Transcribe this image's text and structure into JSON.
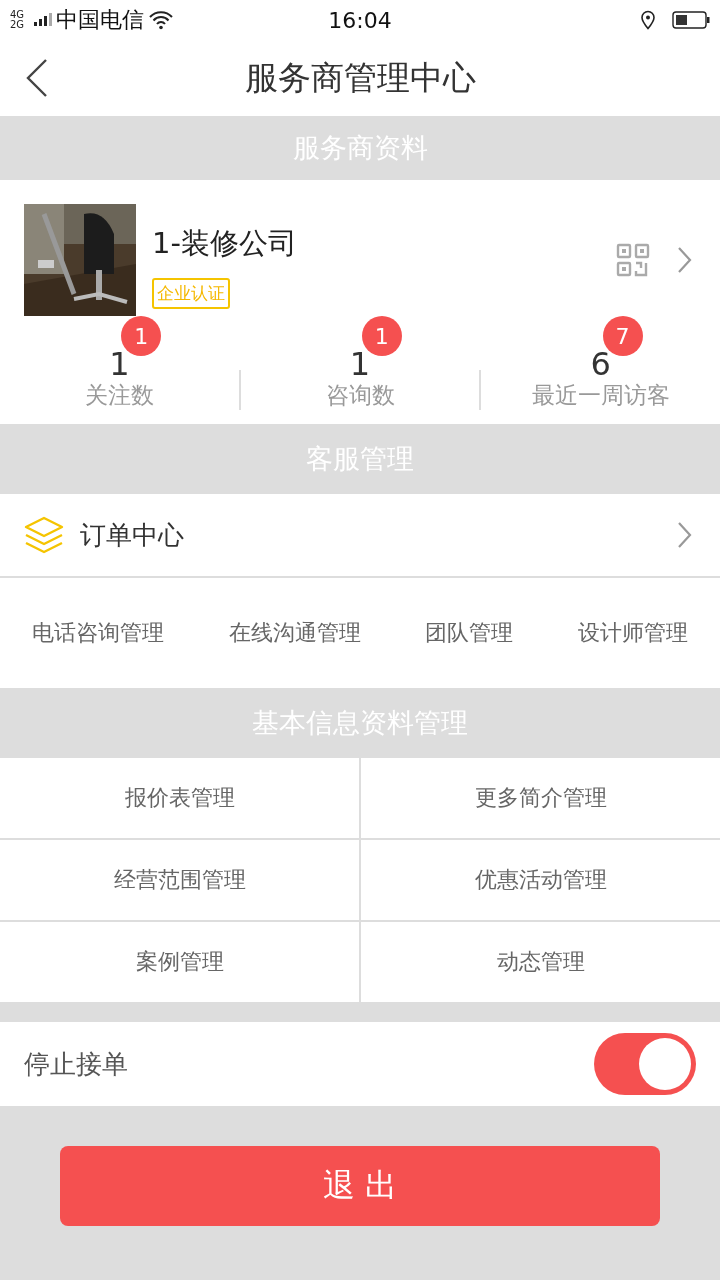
{
  "status_bar": {
    "network": "4G 2G",
    "carrier": "中国电信",
    "time": "16:04"
  },
  "nav": {
    "title": "服务商管理中心"
  },
  "profile_section": {
    "title": "服务商资料"
  },
  "profile": {
    "name": "1-装修公司",
    "badge": "企业认证"
  },
  "stats": [
    {
      "value": "1",
      "badge": "1",
      "label": "关注数"
    },
    {
      "value": "1",
      "badge": "1",
      "label": "咨询数"
    },
    {
      "value": "6",
      "badge": "7",
      "label": "最近一周访客"
    }
  ],
  "service_section": {
    "title": "客服管理"
  },
  "order_center": {
    "label": "订单中心"
  },
  "service_links": [
    "电话咨询管理",
    "在线沟通管理",
    "团队管理",
    "设计师管理"
  ],
  "info_section": {
    "title": "基本信息资料管理"
  },
  "info_grid": [
    "报价表管理",
    "更多简介管理",
    "经营范围管理",
    "优惠活动管理",
    "案例管理",
    "动态管理"
  ],
  "stop_orders": {
    "label": "停止接单",
    "on": true
  },
  "logout_button": "退 出"
}
